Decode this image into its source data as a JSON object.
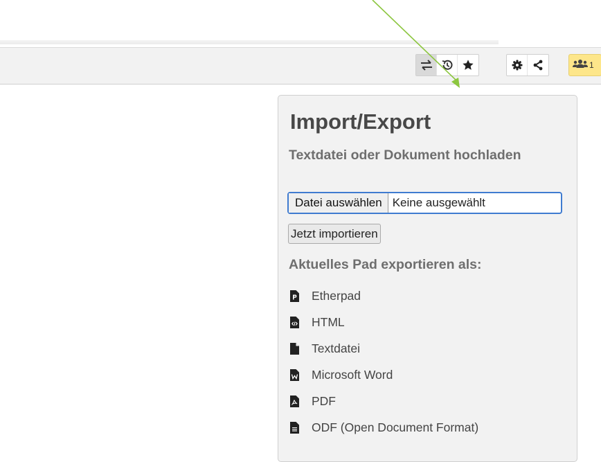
{
  "toolbar": {
    "buttons": [
      {
        "name": "import-export-icon",
        "active": true
      },
      {
        "name": "timeslider-icon",
        "active": false
      },
      {
        "name": "star-icon",
        "active": false
      },
      {
        "name": "gear-icon",
        "active": false
      },
      {
        "name": "share-icon",
        "active": false
      }
    ],
    "users": {
      "icon": "users-icon",
      "count": "1",
      "color": "#fde68a"
    }
  },
  "popup": {
    "title": "Import/Export",
    "import_heading": "Textdatei oder Dokument hochladen",
    "file_input": {
      "button_label": "Datei auswählen",
      "status": "Keine ausgewählt"
    },
    "import_button": "Jetzt importieren",
    "export_heading": "Aktuelles Pad exportieren als:",
    "export_options": [
      {
        "label": "Etherpad",
        "icon": "file-etherpad-icon"
      },
      {
        "label": "HTML",
        "icon": "file-code-icon"
      },
      {
        "label": "Textdatei",
        "icon": "file-text-icon"
      },
      {
        "label": "Microsoft Word",
        "icon": "file-word-icon"
      },
      {
        "label": "PDF",
        "icon": "file-pdf-icon"
      },
      {
        "label": "ODF (Open Document Format)",
        "icon": "file-odf-icon"
      }
    ]
  },
  "colors": {
    "arrow": "#8cc63f",
    "file_input_border": "#3f7bd0",
    "panel_bg": "#f2f2f2"
  }
}
